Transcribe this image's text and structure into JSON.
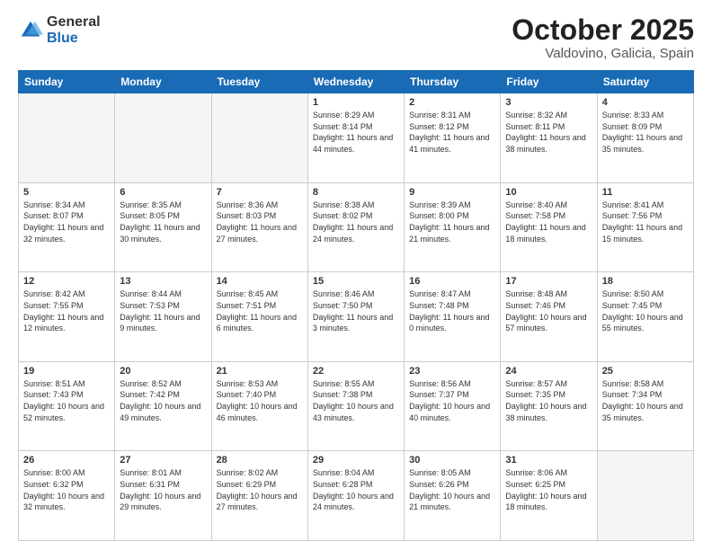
{
  "logo": {
    "general": "General",
    "blue": "Blue"
  },
  "title": {
    "month": "October 2025",
    "location": "Valdovino, Galicia, Spain"
  },
  "weekdays": [
    "Sunday",
    "Monday",
    "Tuesday",
    "Wednesday",
    "Thursday",
    "Friday",
    "Saturday"
  ],
  "weeks": [
    [
      {
        "day": "",
        "info": ""
      },
      {
        "day": "",
        "info": ""
      },
      {
        "day": "",
        "info": ""
      },
      {
        "day": "1",
        "info": "Sunrise: 8:29 AM\nSunset: 8:14 PM\nDaylight: 11 hours\nand 44 minutes."
      },
      {
        "day": "2",
        "info": "Sunrise: 8:31 AM\nSunset: 8:12 PM\nDaylight: 11 hours\nand 41 minutes."
      },
      {
        "day": "3",
        "info": "Sunrise: 8:32 AM\nSunset: 8:11 PM\nDaylight: 11 hours\nand 38 minutes."
      },
      {
        "day": "4",
        "info": "Sunrise: 8:33 AM\nSunset: 8:09 PM\nDaylight: 11 hours\nand 35 minutes."
      }
    ],
    [
      {
        "day": "5",
        "info": "Sunrise: 8:34 AM\nSunset: 8:07 PM\nDaylight: 11 hours\nand 32 minutes."
      },
      {
        "day": "6",
        "info": "Sunrise: 8:35 AM\nSunset: 8:05 PM\nDaylight: 11 hours\nand 30 minutes."
      },
      {
        "day": "7",
        "info": "Sunrise: 8:36 AM\nSunset: 8:03 PM\nDaylight: 11 hours\nand 27 minutes."
      },
      {
        "day": "8",
        "info": "Sunrise: 8:38 AM\nSunset: 8:02 PM\nDaylight: 11 hours\nand 24 minutes."
      },
      {
        "day": "9",
        "info": "Sunrise: 8:39 AM\nSunset: 8:00 PM\nDaylight: 11 hours\nand 21 minutes."
      },
      {
        "day": "10",
        "info": "Sunrise: 8:40 AM\nSunset: 7:58 PM\nDaylight: 11 hours\nand 18 minutes."
      },
      {
        "day": "11",
        "info": "Sunrise: 8:41 AM\nSunset: 7:56 PM\nDaylight: 11 hours\nand 15 minutes."
      }
    ],
    [
      {
        "day": "12",
        "info": "Sunrise: 8:42 AM\nSunset: 7:55 PM\nDaylight: 11 hours\nand 12 minutes."
      },
      {
        "day": "13",
        "info": "Sunrise: 8:44 AM\nSunset: 7:53 PM\nDaylight: 11 hours\nand 9 minutes."
      },
      {
        "day": "14",
        "info": "Sunrise: 8:45 AM\nSunset: 7:51 PM\nDaylight: 11 hours\nand 6 minutes."
      },
      {
        "day": "15",
        "info": "Sunrise: 8:46 AM\nSunset: 7:50 PM\nDaylight: 11 hours\nand 3 minutes."
      },
      {
        "day": "16",
        "info": "Sunrise: 8:47 AM\nSunset: 7:48 PM\nDaylight: 11 hours\nand 0 minutes."
      },
      {
        "day": "17",
        "info": "Sunrise: 8:48 AM\nSunset: 7:46 PM\nDaylight: 10 hours\nand 57 minutes."
      },
      {
        "day": "18",
        "info": "Sunrise: 8:50 AM\nSunset: 7:45 PM\nDaylight: 10 hours\nand 55 minutes."
      }
    ],
    [
      {
        "day": "19",
        "info": "Sunrise: 8:51 AM\nSunset: 7:43 PM\nDaylight: 10 hours\nand 52 minutes."
      },
      {
        "day": "20",
        "info": "Sunrise: 8:52 AM\nSunset: 7:42 PM\nDaylight: 10 hours\nand 49 minutes."
      },
      {
        "day": "21",
        "info": "Sunrise: 8:53 AM\nSunset: 7:40 PM\nDaylight: 10 hours\nand 46 minutes."
      },
      {
        "day": "22",
        "info": "Sunrise: 8:55 AM\nSunset: 7:38 PM\nDaylight: 10 hours\nand 43 minutes."
      },
      {
        "day": "23",
        "info": "Sunrise: 8:56 AM\nSunset: 7:37 PM\nDaylight: 10 hours\nand 40 minutes."
      },
      {
        "day": "24",
        "info": "Sunrise: 8:57 AM\nSunset: 7:35 PM\nDaylight: 10 hours\nand 38 minutes."
      },
      {
        "day": "25",
        "info": "Sunrise: 8:58 AM\nSunset: 7:34 PM\nDaylight: 10 hours\nand 35 minutes."
      }
    ],
    [
      {
        "day": "26",
        "info": "Sunrise: 8:00 AM\nSunset: 6:32 PM\nDaylight: 10 hours\nand 32 minutes."
      },
      {
        "day": "27",
        "info": "Sunrise: 8:01 AM\nSunset: 6:31 PM\nDaylight: 10 hours\nand 29 minutes."
      },
      {
        "day": "28",
        "info": "Sunrise: 8:02 AM\nSunset: 6:29 PM\nDaylight: 10 hours\nand 27 minutes."
      },
      {
        "day": "29",
        "info": "Sunrise: 8:04 AM\nSunset: 6:28 PM\nDaylight: 10 hours\nand 24 minutes."
      },
      {
        "day": "30",
        "info": "Sunrise: 8:05 AM\nSunset: 6:26 PM\nDaylight: 10 hours\nand 21 minutes."
      },
      {
        "day": "31",
        "info": "Sunrise: 8:06 AM\nSunset: 6:25 PM\nDaylight: 10 hours\nand 18 minutes."
      },
      {
        "day": "",
        "info": ""
      }
    ]
  ]
}
